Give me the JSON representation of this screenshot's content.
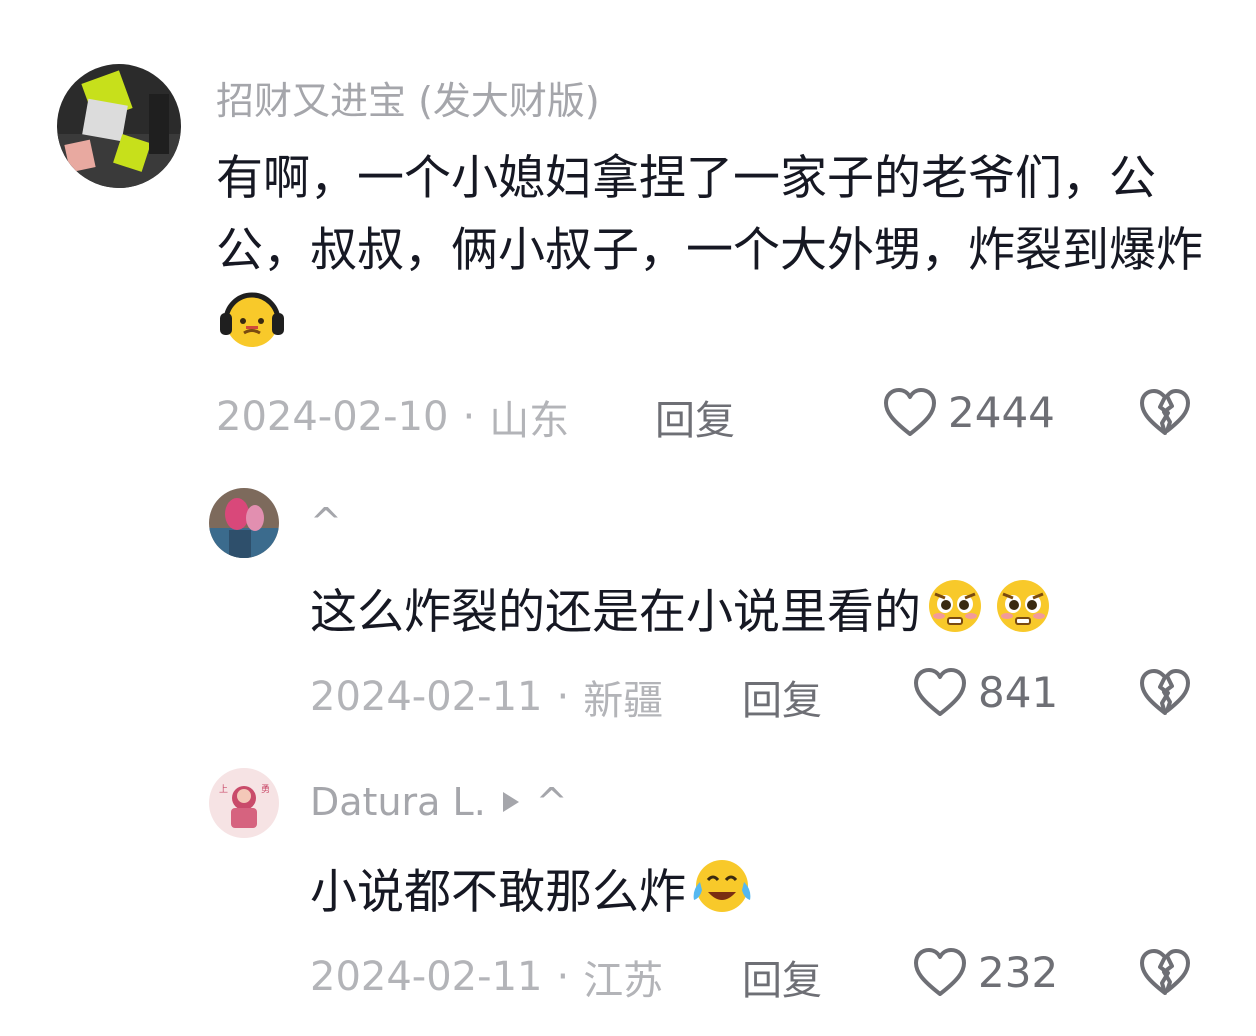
{
  "comments": [
    {
      "username": "招财又进宝 (发大财版)",
      "text": "有啊，一个小媳妇拿捏了一家子的老爷们，公公，叔叔，俩小叔子，一个大外甥，炸裂到爆炸",
      "emoji_icons": [
        "headphone-face-emoji"
      ],
      "date": "2024-02-10",
      "separator": "·",
      "location": "山东",
      "reply_label": "回复",
      "likes": "2444",
      "colors": {
        "avatar_bg": "#2a2a2a",
        "accent": "#c7e01b"
      }
    },
    {
      "username": "^",
      "text": "这么炸裂的还是在小说里看的",
      "emoji_icons": [
        "pleading-face-emoji",
        "pleading-face-emoji"
      ],
      "date": "2024-02-11",
      "separator": "·",
      "location": "新疆",
      "reply_label": "回复",
      "likes": "841",
      "colors": {
        "avatar_bg": "#6f5d4e",
        "accent": "#d9487a"
      }
    },
    {
      "username": "Datura L.",
      "username_suffix": "^",
      "text": "小说都不敢那么炸",
      "emoji_icons": [
        "crying-laughing-emoji"
      ],
      "date": "2024-02-11",
      "separator": "·",
      "location": "江苏",
      "reply_label": "回复",
      "likes": "232",
      "colors": {
        "avatar_bg": "#f3dcdd",
        "accent": "#c94b6a"
      }
    }
  ]
}
